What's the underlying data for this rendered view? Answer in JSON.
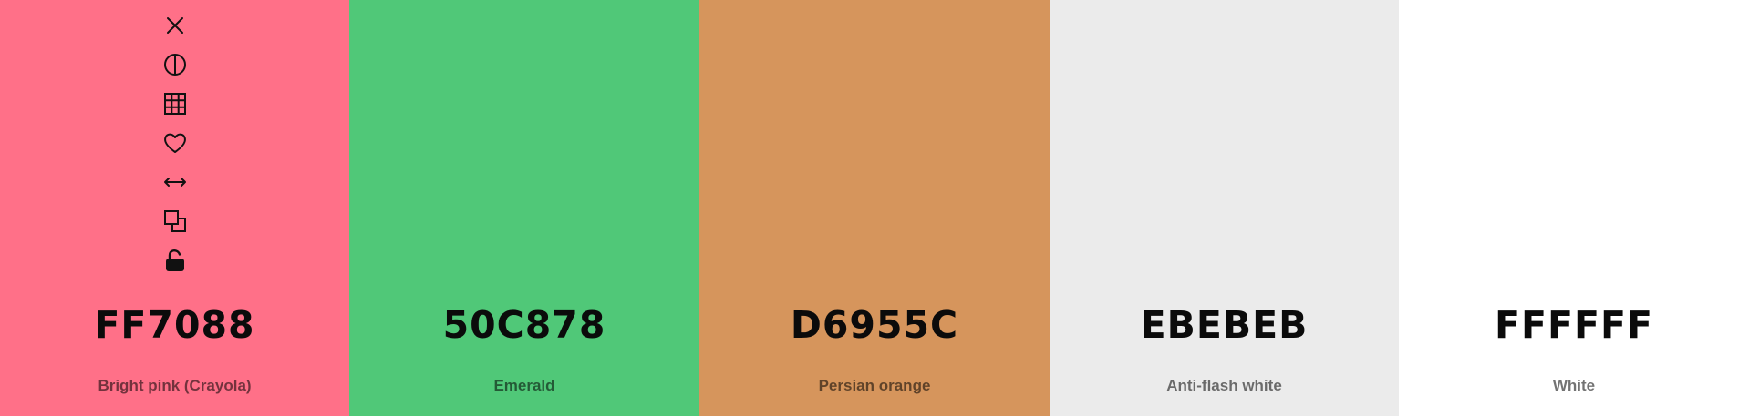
{
  "palette": {
    "colors": [
      {
        "hex": "FF7088",
        "name": "Bright pink (Crayola)",
        "value": "#FF7088"
      },
      {
        "hex": "50C878",
        "name": "Emerald",
        "value": "#50C878"
      },
      {
        "hex": "D6955C",
        "name": "Persian orange",
        "value": "#D6955C"
      },
      {
        "hex": "EBEBEB",
        "name": "Anti-flash white",
        "value": "#EBEBEB"
      },
      {
        "hex": "FFFFFF",
        "name": "White",
        "value": "#FFFFFF"
      }
    ]
  },
  "toolbar": {
    "icons": [
      "close-icon",
      "contrast-icon",
      "grid-icon",
      "heart-icon",
      "arrows-horizontal-icon",
      "copy-icon",
      "unlock-icon"
    ]
  }
}
